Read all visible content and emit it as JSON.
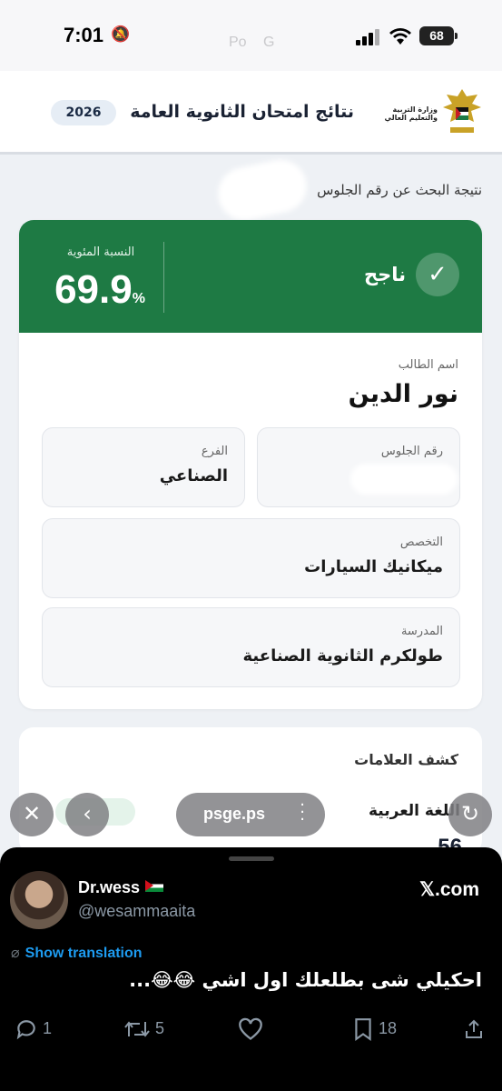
{
  "status_bar": {
    "time": "7:01",
    "battery": "68",
    "faint_left": "Po",
    "faint_right": "G"
  },
  "header": {
    "ministry": "وزارة التربية والتعليم العالي",
    "title": "نتائج امتحان الثانوية العامة",
    "year": "2026"
  },
  "search_caption": "نتيجة البحث عن رقم الجلوس",
  "result": {
    "status": "ناجح",
    "percentage_label": "النسبة المئوية",
    "percentage_value": "69.9",
    "percentage_unit": "%",
    "student_name_label": "اسم الطالب",
    "student_name": "نور الدين",
    "seat_number_label": "رقم الجلوس",
    "branch_label": "الفرع",
    "branch": "الصناعي",
    "specialization_label": "التخصص",
    "specialization": "ميكانيك السيارات",
    "school_label": "المدرسة",
    "school": "طولكرم الثانوية الصناعية"
  },
  "marks": {
    "title": "كشف العلامات",
    "first_subject": "اللغة العربية",
    "first_score_partial": "56"
  },
  "browser_bar": {
    "url": "psge.ps"
  },
  "tweet": {
    "display_name": "Dr.wess",
    "username": "@wesammaaita",
    "source": "𝕏.com",
    "show_translation": "Show translation",
    "text": "احكيلي شى بطلعلك اول اشي 😂😂...",
    "replies": "1",
    "retweets": "5",
    "bookmarks": "18"
  },
  "colors": {
    "success_green": "#1e7a44",
    "link_blue": "#1d9bf0"
  }
}
